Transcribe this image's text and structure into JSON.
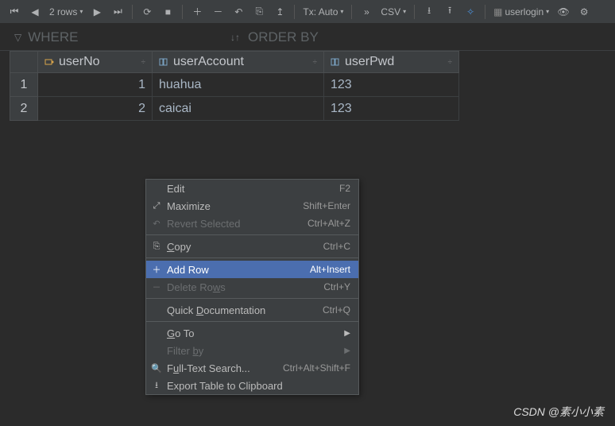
{
  "toolbar": {
    "rows_label": "2 rows",
    "tx_label": "Tx: Auto",
    "csv_label": "CSV",
    "user_label": "userlogin"
  },
  "filter": {
    "where_label": "WHERE",
    "order_label": "ORDER BY"
  },
  "columns": [
    {
      "name": "userNo"
    },
    {
      "name": "userAccount"
    },
    {
      "name": "userPwd"
    }
  ],
  "rows": [
    {
      "idx": "1",
      "userNo": "1",
      "userAccount": "huahua",
      "userPwd": "123"
    },
    {
      "idx": "2",
      "userNo": "2",
      "userAccount": "caicai",
      "userPwd": "123"
    }
  ],
  "menu": {
    "edit": {
      "label": "Edit",
      "shortcut": "F2"
    },
    "maximize": {
      "label": "Maximize",
      "shortcut": "Shift+Enter"
    },
    "revert": {
      "label": "Revert Selected",
      "shortcut": "Ctrl+Alt+Z"
    },
    "copy": {
      "label": "Copy",
      "shortcut": "Ctrl+C"
    },
    "addrow": {
      "label": "Add Row",
      "shortcut": "Alt+Insert"
    },
    "delrows": {
      "label": "Delete Rows",
      "shortcut": "Ctrl+Y"
    },
    "quickdoc": {
      "label": "Quick Documentation",
      "shortcut": "Ctrl+Q"
    },
    "goto": {
      "label": "Go To"
    },
    "filterby": {
      "label": "Filter by"
    },
    "fts": {
      "label": "Full-Text Search...",
      "shortcut": "Ctrl+Alt+Shift+F"
    },
    "export": {
      "label": "Export Table to Clipboard"
    }
  },
  "watermark": "CSDN @素小小素"
}
